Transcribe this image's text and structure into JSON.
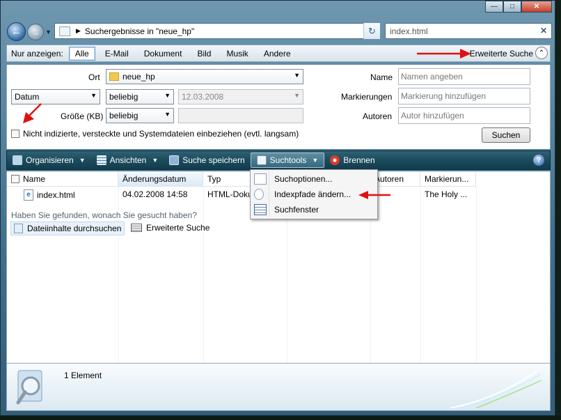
{
  "window": {
    "address_text": "Suchergebnisse in \"neue_hp\"",
    "search_value": "index.html"
  },
  "filter_bar": {
    "label": "Nur anzeigen:",
    "options": [
      "Alle",
      "E-Mail",
      "Dokument",
      "Bild",
      "Musik",
      "Andere"
    ],
    "selected": "Alle",
    "advanced_label": "Erweiterte Suche"
  },
  "advanced": {
    "ort_label": "Ort",
    "ort_value": "neue_hp",
    "date_field": "Datum",
    "date_cond": "beliebig",
    "date_value": "12.03.2008",
    "size_label": "Größe (KB)",
    "size_cond": "beliebig",
    "size_value": "",
    "name_label": "Name",
    "name_placeholder": "Namen angeben",
    "tags_label": "Markierungen",
    "tags_placeholder": "Markierung hinzufügen",
    "authors_label": "Autoren",
    "authors_placeholder": "Autor hinzufügen",
    "include_label": "Nicht indizierte, versteckte und Systemdateien einbeziehen (evtl. langsam)",
    "search_button": "Suchen"
  },
  "toolbar": {
    "organize": "Organisieren",
    "views": "Ansichten",
    "save_search": "Suche speichern",
    "search_tools": "Suchtools",
    "burn": "Brennen"
  },
  "columns": [
    "Name",
    "Änderungsdatum",
    "Typ",
    "Autoren",
    "Markierun..."
  ],
  "rows": [
    {
      "name": "index.html",
      "date": "04.02.2008 14:58",
      "type": "HTML-Doku",
      "tags": "The Holy ..."
    }
  ],
  "hint": "Haben Sie gefunden, wonach Sie gesucht haben?",
  "links": [
    "Dateiinhalte durchsuchen",
    "Erweiterte Suche"
  ],
  "menu": {
    "items": [
      "Suchoptionen...",
      "Indexpfade ändern...",
      "Suchfenster"
    ]
  },
  "details": {
    "count": "1 Element"
  },
  "colors": {
    "annotation_arrow": "#e01010",
    "toolbar": "#1b4b5d"
  }
}
